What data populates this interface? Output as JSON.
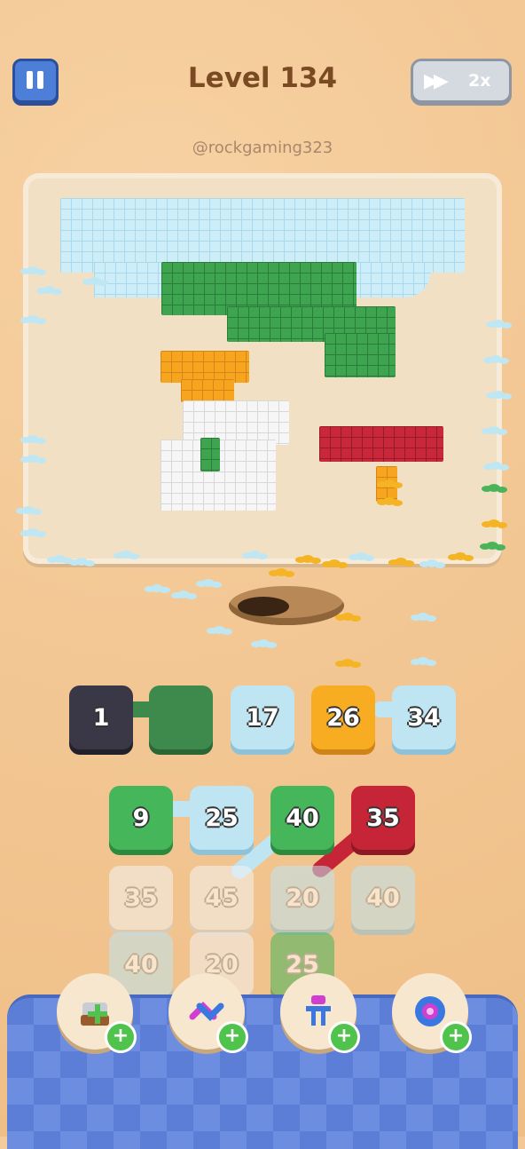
{
  "header": {
    "level_label": "Level 134",
    "speed_label": "2x",
    "pause_icon": "pause-icon",
    "speed_icon": "fast-forward-icon"
  },
  "watermark": "@rockgaming323",
  "queue_row": [
    {
      "value": "1",
      "color": "dark"
    },
    {
      "value": "",
      "color": "dgreen"
    },
    {
      "value": "17",
      "color": "ice"
    },
    {
      "value": "26",
      "color": "orange"
    },
    {
      "value": "34",
      "color": "ice"
    }
  ],
  "grid": [
    [
      {
        "value": "9",
        "color": "green"
      },
      {
        "value": "25",
        "color": "ice"
      },
      {
        "value": "40",
        "color": "green"
      },
      {
        "value": "35",
        "color": "red"
      }
    ],
    [
      {
        "value": "35",
        "color": "white"
      },
      {
        "value": "45",
        "color": "white"
      },
      {
        "value": "20",
        "color": "ice"
      },
      {
        "value": "40",
        "color": "ice"
      }
    ],
    [
      {
        "value": "40",
        "color": "ice"
      },
      {
        "value": "20",
        "color": "white"
      },
      {
        "value": "25",
        "color": "green"
      }
    ]
  ],
  "powerups": [
    {
      "name": "add-slot-icon"
    },
    {
      "name": "shuffle-icon"
    },
    {
      "name": "magnet-icon"
    },
    {
      "name": "hammer-icon"
    }
  ],
  "colors": {
    "board": "#f2e0c5",
    "ice": "#bfe5f3",
    "green": "#46b65b",
    "orange": "#f8ac22",
    "red": "#c52536",
    "tray": "#5c7ed6"
  }
}
